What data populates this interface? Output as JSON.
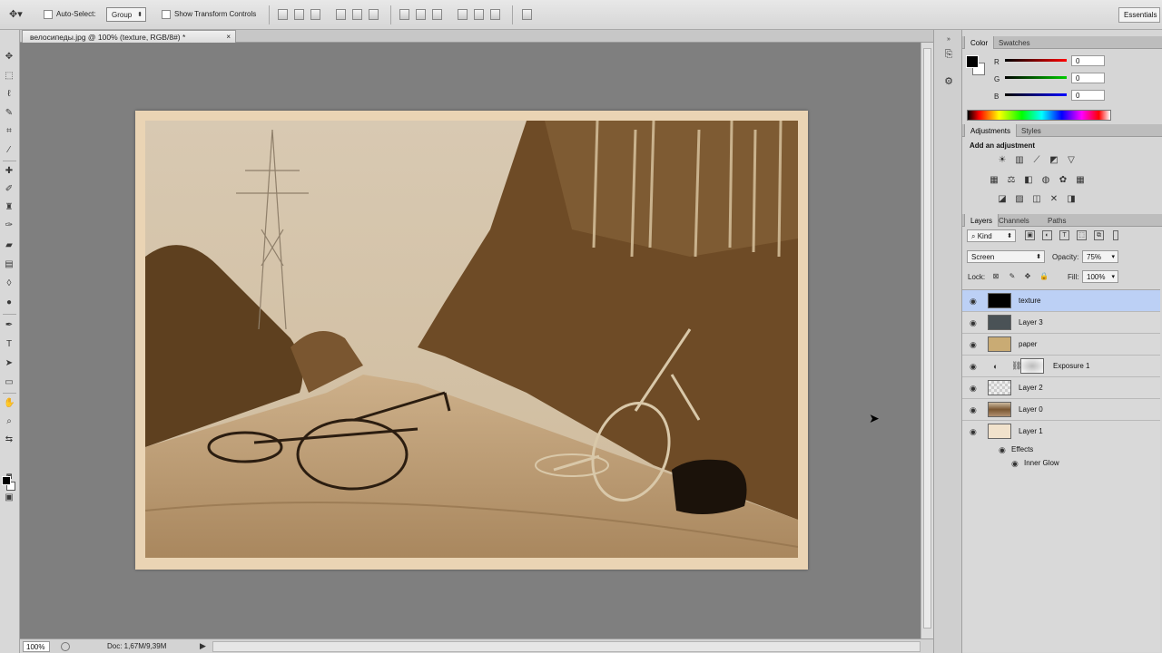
{
  "options_bar": {
    "auto_select_label": "Auto-Select:",
    "auto_select_target": "Group",
    "transform_controls_label": "Show Transform Controls",
    "workspace": "Essentials"
  },
  "document": {
    "tab_title": "велосипеды.jpg @ 100% (texture, RGB/8#) *",
    "zoom": "100%",
    "doc_info": "Doc: 1,67M/9,39M"
  },
  "color_panel": {
    "tabs": [
      "Color",
      "Swatches"
    ],
    "r_label": "R",
    "g_label": "G",
    "b_label": "B",
    "r": "0",
    "g": "0",
    "b": "0",
    "foreground": "#000000",
    "background": "#ffffff"
  },
  "adjustments_panel": {
    "tabs": [
      "Adjustments",
      "Styles"
    ],
    "title": "Add an adjustment"
  },
  "layers_panel": {
    "tabs": [
      "Layers",
      "Channels",
      "Paths"
    ],
    "filter_kind": "Kind",
    "blend_mode": "Screen",
    "opacity_label": "Opacity:",
    "opacity": "75%",
    "lock_label": "Lock:",
    "fill_label": "Fill:",
    "fill": "100%",
    "layers": [
      {
        "name": "texture",
        "selected": true,
        "thumb": "#000000"
      },
      {
        "name": "Layer 3",
        "selected": false,
        "thumb": "#4a5256"
      },
      {
        "name": "paper",
        "selected": false,
        "thumb": "#c9ab74"
      },
      {
        "name": "Exposure 1",
        "selected": false,
        "thumb": "#ffffff"
      },
      {
        "name": "Layer 2",
        "selected": false,
        "thumb": "#eeeeee"
      },
      {
        "name": "Layer 0",
        "selected": false,
        "thumb": "#8c6a44"
      },
      {
        "name": "Layer 1",
        "selected": false,
        "thumb": "#f1e2cc"
      }
    ],
    "effects_label": "Effects",
    "inner_glow_label": "Inner Glow"
  }
}
